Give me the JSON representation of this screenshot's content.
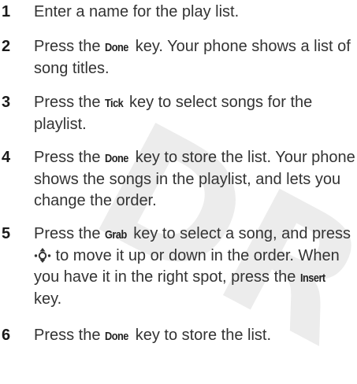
{
  "watermark": "DR",
  "steps": [
    {
      "number": "1",
      "text": "Enter a name for the play list."
    },
    {
      "number": "2",
      "before": "Press the ",
      "key": "Done",
      "after": " key. Your phone shows a list of song titles."
    },
    {
      "number": "3",
      "before": "Press the ",
      "key": "Tick",
      "after": " key to select songs for the playlist."
    },
    {
      "number": "4",
      "before": "Press the ",
      "key": "Done",
      "after": " key to store the list. Your phone shows the songs in the playlist, and lets you change the order."
    },
    {
      "number": "5",
      "before": "Press the ",
      "key": "Grab",
      "middle1": " key to select a song, and press ",
      "icon": "navigation-key-icon",
      "middle2": " to move it up or down in the order. When you have it in the right spot, press the ",
      "key2": "Insert",
      "after": " key."
    },
    {
      "number": "6",
      "before": "Press the ",
      "key": "Done",
      "after": " key to store the list."
    }
  ]
}
